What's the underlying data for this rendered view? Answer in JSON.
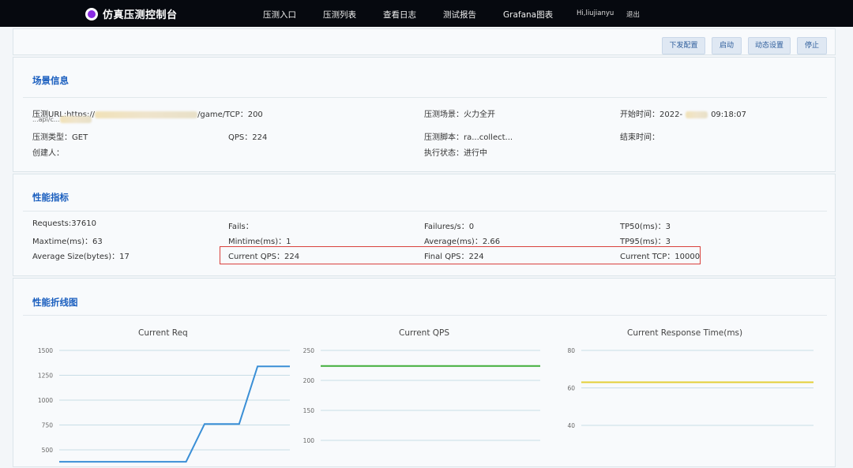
{
  "topbar": {
    "title": "仿真压测控制台",
    "nav": [
      "压测入口",
      "压测列表",
      "查看日志",
      "测试报告",
      "Grafana图表"
    ],
    "user": "Hi,liujianyu",
    "logout": "退出"
  },
  "actions": [
    "下发配置",
    "启动",
    "动态设置",
    "停止"
  ],
  "scene": {
    "title": "场景信息",
    "url_label": "压测URL:https://",
    "url_tail": "/game/TCP：200",
    "url_line2": "...api/c...",
    "scene_label": "压测场景：",
    "scene_value": "火力全开",
    "start_label": "开始时间：",
    "start_value": "2022-",
    "start_time": "09:18:07",
    "type_label": "压测类型：",
    "type_value": "GET",
    "qps_label": "QPS：",
    "qps_value": "224",
    "script_label": "压测脚本：",
    "script_value": "ra...collect...",
    "end_label": "结束时间：",
    "creator_label": "创建人：",
    "status_label": "执行状态：",
    "status_value": "进行中"
  },
  "perf": {
    "title": "性能指标",
    "requests": "Requests:37610",
    "fails": "Fails：",
    "failures_s": "Failures/s：0",
    "tp50": "TP50(ms)：3",
    "maxtime": "Maxtime(ms)：63",
    "mintime": "Mintime(ms)：1",
    "average": "Average(ms)：2.66",
    "tp95": "TP95(ms)：3",
    "avg_size": "Average Size(bytes)：17",
    "current_qps": "Current QPS：224",
    "final_qps": "Final QPS：224",
    "current_tcp": "Current TCP：10000"
  },
  "charts_section": {
    "title": "性能折线图"
  },
  "chart_data": [
    {
      "type": "line",
      "title": "Current Req",
      "y_ticks": [
        1500,
        1250,
        1000,
        750,
        500
      ],
      "ylim": [
        500,
        1500
      ],
      "color": "#3a8fd6",
      "series": [
        {
          "x": [
            0,
            0.55,
            0.63,
            0.78,
            0.86,
            1.0
          ],
          "y": [
            380,
            380,
            760,
            760,
            1340,
            1340
          ]
        }
      ]
    },
    {
      "type": "line",
      "title": "Current QPS",
      "y_ticks": [
        250,
        200,
        150,
        100
      ],
      "ylim": [
        100,
        250
      ],
      "color": "#3fae3a",
      "series": [
        {
          "x": [
            0.0,
            1.0
          ],
          "y": [
            224,
            224
          ]
        }
      ]
    },
    {
      "type": "line",
      "title": "Current Response Time(ms)",
      "y_ticks": [
        80,
        60,
        40
      ],
      "ylim": [
        40,
        80
      ],
      "color": "#e4d03a",
      "series": [
        {
          "x": [
            0.0,
            1.0
          ],
          "y": [
            63,
            63
          ]
        }
      ]
    }
  ]
}
